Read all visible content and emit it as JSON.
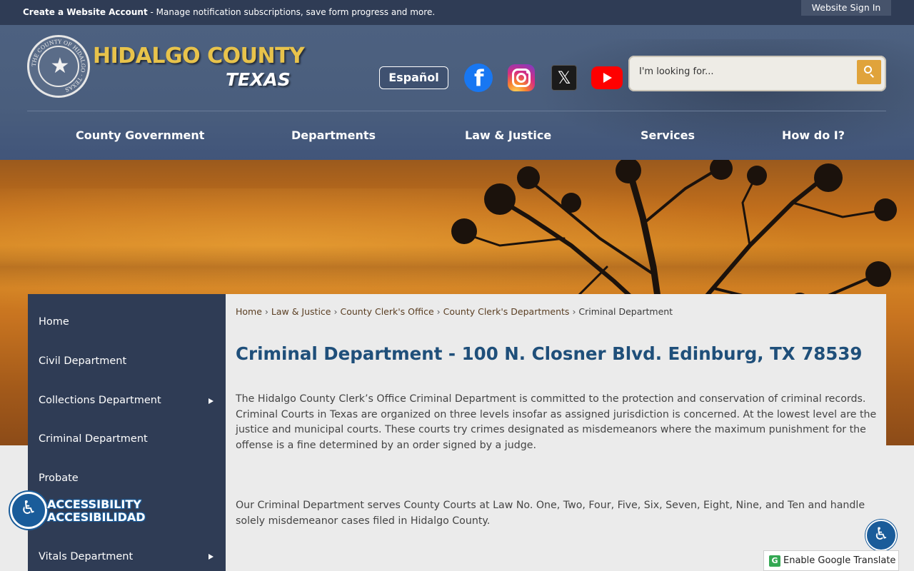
{
  "topbar": {
    "account_link": "Create a Website Account",
    "account_desc": " - Manage notification subscriptions, save form progress and more.",
    "sign_in": "Website Sign In"
  },
  "header": {
    "brand_title": "HIDALGO COUNTY",
    "brand_sub": "TEXAS",
    "seal_text": "THE COUNTY OF HIDALGO · TEXAS",
    "language_button": "Español",
    "social": [
      "facebook-icon",
      "instagram-icon",
      "x-twitter-icon",
      "youtube-icon"
    ],
    "search": {
      "placeholder": "I'm looking for..."
    },
    "colors": {
      "brand_gold": "#e8c34b",
      "nav_bg": "#4a5e7d",
      "search_button": "#e0a33b"
    }
  },
  "nav": {
    "items": [
      {
        "label": "County Government"
      },
      {
        "label": "Departments"
      },
      {
        "label": "Law & Justice"
      },
      {
        "label": "Services"
      },
      {
        "label": "How do I?"
      }
    ]
  },
  "sidebar": {
    "items": [
      {
        "label": "Home",
        "has_submenu": false
      },
      {
        "label": "Civil Department",
        "has_submenu": false
      },
      {
        "label": "Collections Department",
        "has_submenu": true
      },
      {
        "label": "Criminal Department",
        "has_submenu": false
      },
      {
        "label": "Probate",
        "has_submenu": false
      },
      {
        "label": "Vitals Department",
        "has_submenu": true
      }
    ]
  },
  "breadcrumb": {
    "items": [
      "Home",
      "Law & Justice",
      "County Clerk's Office",
      "County Clerk's Departments"
    ],
    "current": "Criminal Department",
    "separator": "›"
  },
  "main": {
    "title": "Criminal Department - 100 N. Closner Blvd. Edinburg, TX 78539",
    "paragraphs": [
      "The Hidalgo County Clerk’s Office Criminal Department is committed to the protection and conservation of criminal records. Criminal Courts in Texas are organized on three levels insofar as assigned jurisdiction is concerned. At the lowest level are the justice and municipal courts. These courts try crimes designated as misdemeanors where the maximum punishment for the offense is a fine determined by an order signed by a judge.",
      "Our Criminal Department serves County Courts at Law No. One, Two, Four, Five, Six, Seven, Eight, Nine, and Ten and handle solely misdemeanor cases filed in Hidalgo County."
    ]
  },
  "widgets": {
    "accessibility_line1": "ACCESSIBILITY",
    "accessibility_line2": "ACCESIBILIDAD",
    "google_translate": "Enable Google Translate"
  }
}
